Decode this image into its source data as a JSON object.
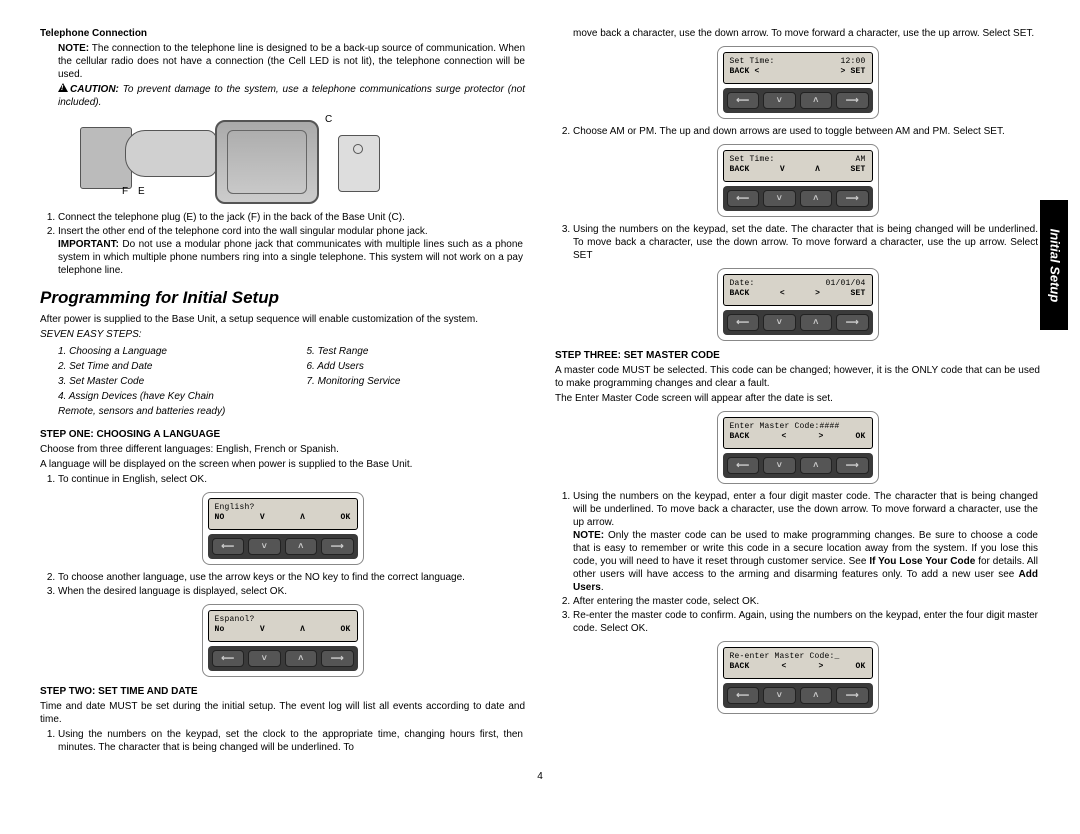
{
  "side_tab": "Initial Setup",
  "page_number": "4",
  "col1": {
    "telephone_heading": "Telephone Connection",
    "note_label": "NOTE:",
    "note_text": " The connection to the telephone line is designed to be a back-up source of communication. When the cellular radio does not have a connection (the Cell LED is not lit), the telephone connection will be used.",
    "caution_label": "CAUTION:",
    "caution_text": " To prevent damage to the system, use a telephone communications surge protector (not included).",
    "illus_labels": {
      "C": "C",
      "F": "F",
      "E": "E"
    },
    "tele_li1": "Connect the telephone plug (E) to the jack (F) in the back of the Base Unit (C).",
    "tele_li2": "Insert the other end of the telephone cord into the wall singular modular phone jack.",
    "important_label": "IMPORTANT:",
    "important_text": " Do not use a modular phone jack that communicates with multiple lines such as a phone system in which multiple phone numbers ring into a single telephone. This system will not work on a pay telephone line.",
    "prog_heading": "Programming for Initial Setup",
    "prog_intro": "After power is supplied to the Base Unit, a setup sequence will enable customization of the system.",
    "seven_heading": "SEVEN EASY STEPS:",
    "steps_left": [
      "1. Choosing a Language",
      "2. Set Time and Date",
      "3. Set Master Code",
      "4. Assign Devices (have Key Chain",
      "    Remote, sensors and batteries ready)"
    ],
    "steps_right": [
      "5. Test Range",
      "6. Add Users",
      "7. Monitoring Service"
    ],
    "step1_heading": "STEP ONE: CHOOSING A LANGUAGE",
    "step1_p1": "Choose from three different languages: English, French or Spanish.",
    "step1_p2": "A language will be displayed on the screen when power is supplied to the Base Unit.",
    "step1_li1": "To continue in English, select OK.",
    "step1_li2": "To choose another language, use the arrow keys or the NO key to find the correct language.",
    "step1_li3": "When the desired language is displayed, select OK.",
    "step2_heading": "STEP TWO: SET TIME AND DATE",
    "step2_p1": "Time and date MUST be set during the initial setup. The event log will list all events according to date and time.",
    "step2_li1": "Using the numbers on the keypad, set the clock to the appropriate time, changing hours first, then minutes. The character that is being changed will be underlined. To"
  },
  "col2": {
    "cont_text": "move back a character, use the down arrow. To move forward a character, use the up arrow. Select SET.",
    "li2": "Choose AM or PM. The up and down arrows are used to toggle between AM and PM. Select SET.",
    "li3": "Using the numbers on the keypad, set the date. The character that is being changed will be underlined. To move back a character, use the down arrow. To move forward a character, use the up arrow. Select SET",
    "step3_heading": "STEP THREE: SET MASTER CODE",
    "step3_p1": "A master code MUST be selected. This code can be changed; however, it is the ONLY code that can be used to make programming changes and clear a fault.",
    "step3_p2": "The Enter Master Code screen will appear after the date is set.",
    "s3_li1": "Using the numbers on the keypad, enter a four digit master code. The character that is being changed will be underlined. To move back a character, use the down arrow. To move forward a character, use the up arrow.",
    "s3_note_label": "NOTE:",
    "s3_note": " Only the master code can be used to make programming changes. Be sure to choose a code that is easy to remember or write this code in a secure location away from the system. If you lose this code, you will need to have it reset through customer service. See ",
    "s3_note_bold": "If You Lose Your Code",
    "s3_note2": " for details. All other users will have access to the arming and disarming features only. To add a new user see ",
    "s3_note_bold2": "Add Users",
    "s3_note3": ".",
    "s3_li2": "After entering the master code, select OK.",
    "s3_li3": "Re-enter the master code to confirm. Again, using the numbers on the keypad, enter the four digit master code. Select OK."
  },
  "devices": {
    "english": {
      "l1": "English?",
      "a": "NO",
      "b": "V",
      "c": "Λ",
      "d": "OK"
    },
    "espanol": {
      "l1": "Espanol?",
      "a": "No",
      "b": "V",
      "c": "Λ",
      "d": "OK"
    },
    "settime": {
      "l1a": "Set Time:",
      "l1b": "12:00",
      "a": "BACK <",
      "d": "> SET"
    },
    "setam": {
      "l1a": "Set Time:",
      "l1b": "AM",
      "a": "BACK",
      "b": "V",
      "c": "Λ",
      "d": "SET"
    },
    "date": {
      "l1a": "Date:",
      "l1b": "01/01/04",
      "a": "BACK",
      "b": "<",
      "c": ">",
      "d": "SET"
    },
    "master": {
      "l1": "Enter Master Code:####",
      "a": "BACK",
      "b": "<",
      "c": ">",
      "d": "OK"
    },
    "reenter": {
      "l1": "Re-enter Master Code:_",
      "a": "BACK",
      "b": "<",
      "c": ">",
      "d": "OK"
    }
  },
  "buttons": {
    "left": "⟵",
    "down": "˅",
    "up": "˄",
    "right": "⟶"
  }
}
